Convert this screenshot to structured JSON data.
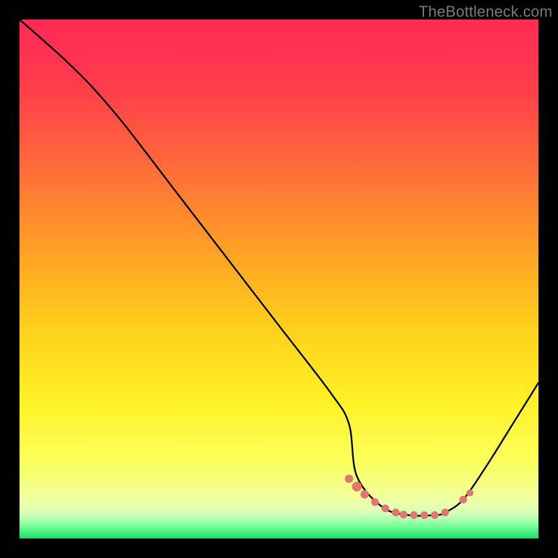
{
  "watermark": "TheBottleneck.com",
  "chart_data": {
    "type": "line",
    "title": "",
    "xlabel": "",
    "ylabel": "",
    "xlim": [
      0,
      100
    ],
    "ylim": [
      0,
      100
    ],
    "gradient_bands": [
      {
        "stop": 0.0,
        "color": "#ff2a55"
      },
      {
        "stop": 0.12,
        "color": "#ff3a4d"
      },
      {
        "stop": 0.28,
        "color": "#ff6a3a"
      },
      {
        "stop": 0.45,
        "color": "#ffa224"
      },
      {
        "stop": 0.6,
        "color": "#ffd21c"
      },
      {
        "stop": 0.74,
        "color": "#fff227"
      },
      {
        "stop": 0.85,
        "color": "#fbff5a"
      },
      {
        "stop": 0.905,
        "color": "#f4ff8c"
      },
      {
        "stop": 0.935,
        "color": "#eaffad"
      },
      {
        "stop": 0.955,
        "color": "#cdffb8"
      },
      {
        "stop": 0.975,
        "color": "#7bff9a"
      },
      {
        "stop": 1.0,
        "color": "#18e06a"
      }
    ],
    "series": [
      {
        "name": "curve",
        "x": [
          0.0,
          4.0,
          9.0,
          14.0,
          20.0,
          30.0,
          40.0,
          50.0,
          60.0,
          63.5,
          65.0,
          70.0,
          75.0,
          80.0,
          82.0,
          85.5,
          90.0,
          95.0,
          100.0
        ],
        "y": [
          100.0,
          96.5,
          92.0,
          87.0,
          80.0,
          67.0,
          54.0,
          41.0,
          28.0,
          22.0,
          12.0,
          6.0,
          4.5,
          4.5,
          5.0,
          7.5,
          14.0,
          22.0,
          30.0
        ]
      }
    ],
    "highlight_points": {
      "name": "highlight",
      "color": "#e57373",
      "x": [
        63.5,
        65.0,
        66.5,
        68.5,
        70.5,
        72.5,
        74.0,
        76.0,
        78.0,
        80.0,
        82.0,
        85.5,
        86.8
      ],
      "y": [
        11.5,
        10.0,
        8.5,
        7.0,
        5.8,
        5.0,
        4.6,
        4.5,
        4.5,
        4.5,
        5.0,
        7.5,
        8.8
      ],
      "r": [
        6,
        7,
        6,
        5.5,
        5.5,
        5.5,
        5.5,
        5.5,
        5.5,
        5.5,
        5.5,
        5.5,
        5
      ]
    }
  }
}
